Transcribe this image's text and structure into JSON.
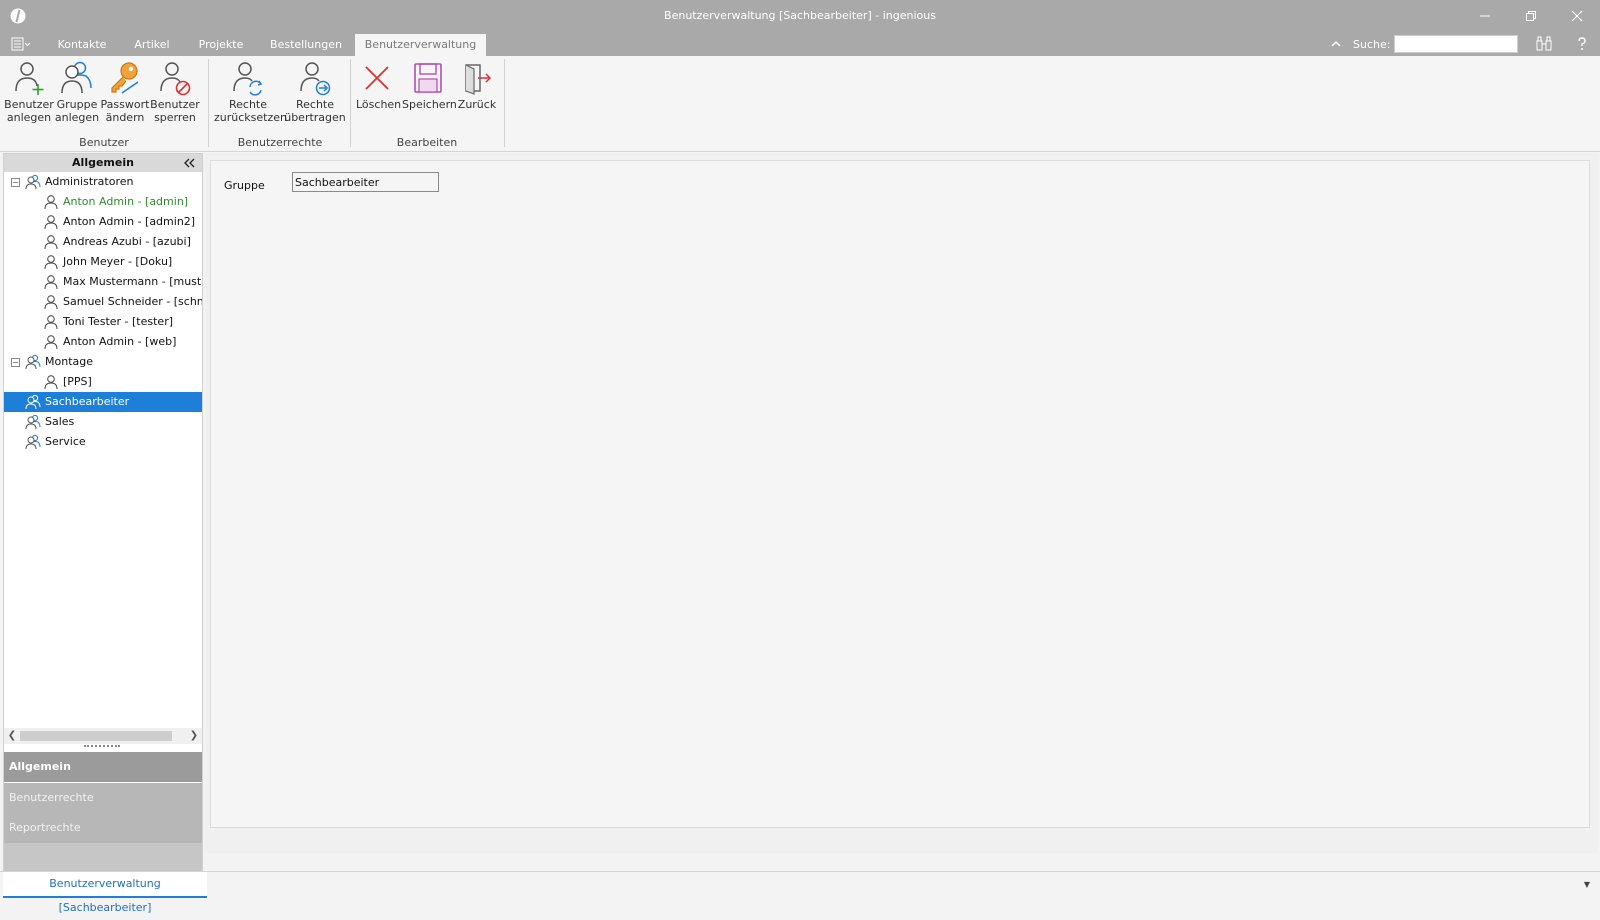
{
  "window": {
    "title": "Benutzerverwaltung [Sachbearbeiter] - ingenious"
  },
  "tabs": [
    {
      "label": "Kontakte"
    },
    {
      "label": "Artikel"
    },
    {
      "label": "Projekte"
    },
    {
      "label": "Bestellungen"
    },
    {
      "label": "Benutzerverwaltung",
      "active": true
    }
  ],
  "search": {
    "label": "Suche:",
    "value": ""
  },
  "ribbon": {
    "groups": [
      {
        "label": "Benutzer",
        "buttons": [
          {
            "label": "Benutzer\nanlegen",
            "icon": "add-user-icon"
          },
          {
            "label": "Gruppe\nanlegen",
            "icon": "add-group-icon"
          },
          {
            "label": "Passwort\nändern",
            "icon": "key-icon"
          },
          {
            "label": "Benutzer\nsperren",
            "icon": "lock-user-icon"
          }
        ]
      },
      {
        "label": "Benutzerrechte",
        "buttons": [
          {
            "label": "Rechte\nzurücksetzen",
            "icon": "reset-rights-icon"
          },
          {
            "label": "Rechte\nübertragen",
            "icon": "transfer-rights-icon"
          }
        ]
      },
      {
        "label": "Bearbeiten",
        "buttons": [
          {
            "label": "Löschen",
            "icon": "delete-icon"
          },
          {
            "label": "Speichern",
            "icon": "save-icon"
          },
          {
            "label": "Zurück",
            "icon": "exit-icon"
          }
        ]
      }
    ]
  },
  "nav": {
    "header": "Allgemein",
    "tree": [
      {
        "label": "Administratoren",
        "type": "group",
        "level": 0,
        "expanded": true
      },
      {
        "label": "Anton Admin - [admin]",
        "type": "user",
        "level": 1,
        "highlight": "green"
      },
      {
        "label": "Anton Admin - [admin2]",
        "type": "user",
        "level": 1
      },
      {
        "label": "Andreas Azubi - [azubi]",
        "type": "user",
        "level": 1
      },
      {
        "label": "John Meyer - [Doku]",
        "type": "user",
        "level": 1
      },
      {
        "label": "Max Mustermann - [musterma",
        "type": "user",
        "level": 1
      },
      {
        "label": "Samuel Schneider - [schneide",
        "type": "user",
        "level": 1
      },
      {
        "label": "Toni Tester - [tester]",
        "type": "user",
        "level": 1
      },
      {
        "label": "Anton Admin - [web]",
        "type": "user",
        "level": 1
      },
      {
        "label": "Montage",
        "type": "group",
        "level": 0,
        "expanded": true
      },
      {
        "label": "[PPS]",
        "type": "user",
        "level": 1
      },
      {
        "label": "Sachbearbeiter",
        "type": "group",
        "level": 0,
        "selected": true
      },
      {
        "label": "Sales",
        "type": "group",
        "level": 0
      },
      {
        "label": "Service",
        "type": "group",
        "level": 0
      }
    ],
    "sections": [
      {
        "label": "Allgemein",
        "active": true
      },
      {
        "label": "Benutzerrechte"
      },
      {
        "label": "Reportrechte"
      }
    ]
  },
  "form": {
    "group_label": "Gruppe",
    "group_value": "Sachbearbeiter"
  },
  "doc_tab": {
    "label": "Benutzerverwaltung [Sachbearbeiter]"
  },
  "colors": {
    "titlebar": "#a9a9a9",
    "selection": "#1e7fd8",
    "highlight_text": "#2e8b2e"
  }
}
